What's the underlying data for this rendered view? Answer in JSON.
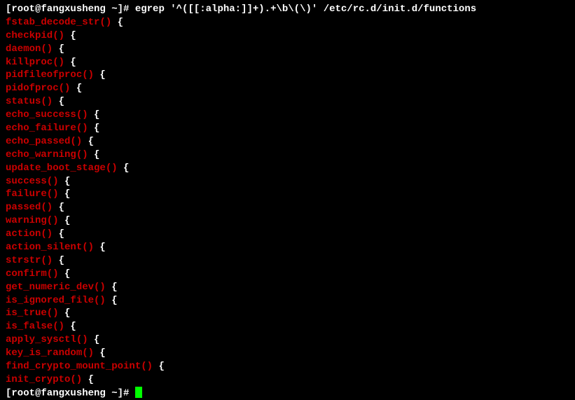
{
  "prompt1": "[root@fangxusheng ~]# ",
  "command": "egrep '^([[:alpha:]]+).+\\b\\(\\)' /etc/rc.d/init.d/functions",
  "lines": [
    {
      "match": "fstab_decode_str()",
      "suffix": " {"
    },
    {
      "match": "checkpid()",
      "suffix": " {"
    },
    {
      "match": "daemon()",
      "suffix": " {"
    },
    {
      "match": "killproc()",
      "suffix": " {"
    },
    {
      "match": "pidfileofproc()",
      "suffix": " {"
    },
    {
      "match": "pidofproc()",
      "suffix": " {"
    },
    {
      "match": "status()",
      "suffix": " {"
    },
    {
      "match": "echo_success()",
      "suffix": " {"
    },
    {
      "match": "echo_failure()",
      "suffix": " {"
    },
    {
      "match": "echo_passed()",
      "suffix": " {"
    },
    {
      "match": "echo_warning()",
      "suffix": " {"
    },
    {
      "match": "update_boot_stage()",
      "suffix": " {"
    },
    {
      "match": "success()",
      "suffix": " {"
    },
    {
      "match": "failure()",
      "suffix": " {"
    },
    {
      "match": "passed()",
      "suffix": " {"
    },
    {
      "match": "warning()",
      "suffix": " {"
    },
    {
      "match": "action()",
      "suffix": " {"
    },
    {
      "match": "action_silent()",
      "suffix": " {"
    },
    {
      "match": "strstr()",
      "suffix": " {"
    },
    {
      "match": "confirm()",
      "suffix": " {"
    },
    {
      "match": "get_numeric_dev()",
      "suffix": " {"
    },
    {
      "match": "is_ignored_file()",
      "suffix": " {"
    },
    {
      "match": "is_true()",
      "suffix": " {"
    },
    {
      "match": "is_false()",
      "suffix": " {"
    },
    {
      "match": "apply_sysctl()",
      "suffix": " {"
    },
    {
      "match": "key_is_random()",
      "suffix": " {"
    },
    {
      "match": "find_crypto_mount_point()",
      "suffix": " {"
    },
    {
      "match": "init_crypto()",
      "suffix": " {"
    }
  ],
  "prompt2": "[root@fangxusheng ~]# "
}
